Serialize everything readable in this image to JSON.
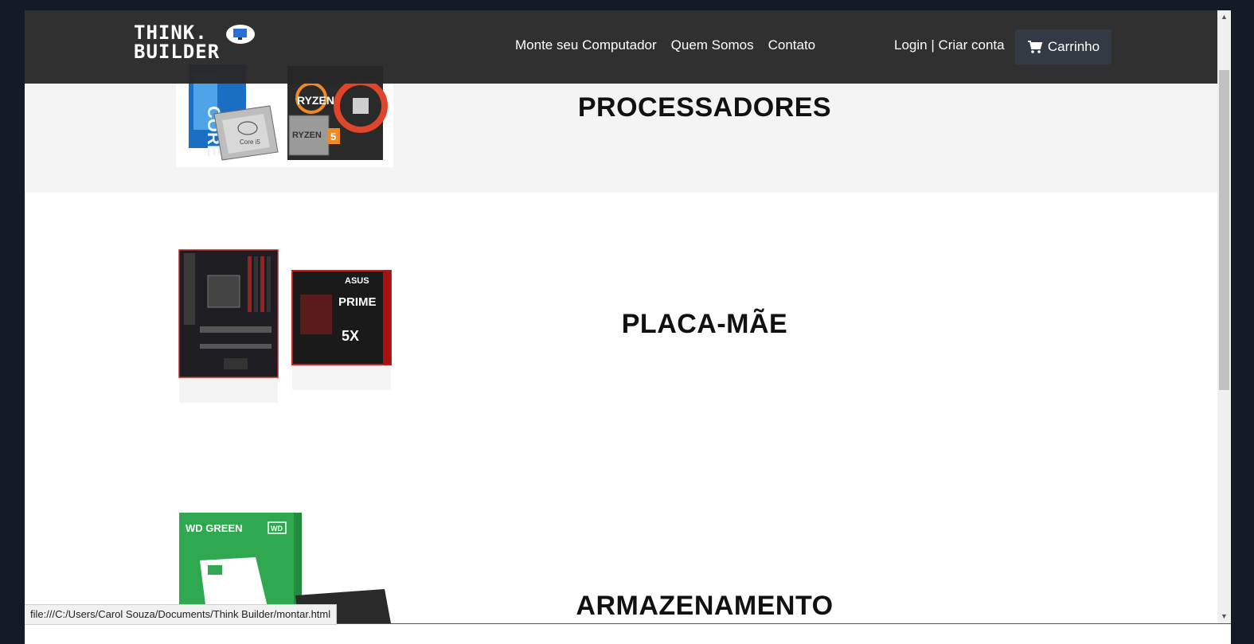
{
  "header": {
    "logo_line1": "THINK.",
    "logo_line2": "BUILDER",
    "nav": [
      "Monte seu Computador",
      "Quem Somos",
      "Contato"
    ],
    "auth_text": "Login | Criar conta",
    "cart_label": "Carrinho",
    "cart_icon": "shopping-cart-icon"
  },
  "categories": [
    {
      "title": "PROCESSADORES",
      "image": "intel-core-i5-and-amd-ryzen-5-boxes"
    },
    {
      "title": "PLACA-MÃE",
      "image": "asus-prime-motherboard-and-box"
    },
    {
      "title": "ARMAZENAMENTO",
      "image": "wd-green-ssd-box"
    }
  ],
  "status_bar": {
    "url": "file:///C:/Users/Carol Souza/Documents/Think Builder/montar.html"
  },
  "colors": {
    "navbar": "#282828",
    "section_alt": "#f4f4f4",
    "cart_button": "#343a44",
    "wd_green": "#2fa84f"
  }
}
